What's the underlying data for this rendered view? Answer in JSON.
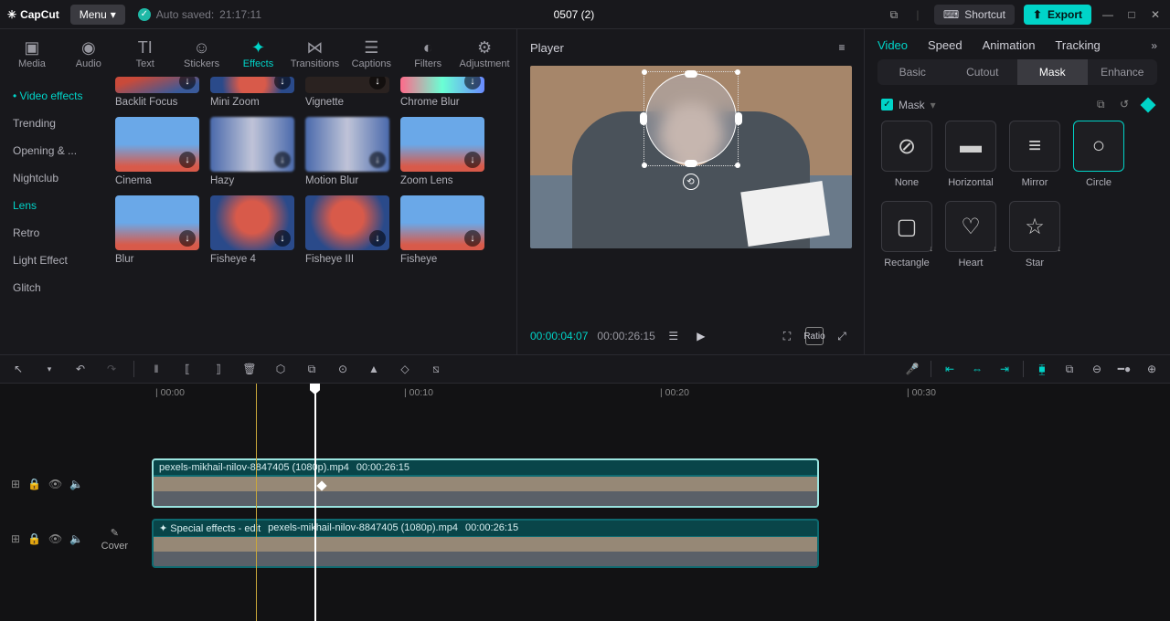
{
  "topbar": {
    "brand": "CapCut",
    "menu": "Menu",
    "autosave_label": "Auto saved:",
    "autosave_time": "21:17:11",
    "title": "0507 (2)",
    "shortcut": "Shortcut",
    "export": "Export"
  },
  "mediaTabs": [
    {
      "label": "Media",
      "icon": "▣"
    },
    {
      "label": "Audio",
      "icon": "◉"
    },
    {
      "label": "Text",
      "icon": "TI"
    },
    {
      "label": "Stickers",
      "icon": "☺"
    },
    {
      "label": "Effects",
      "icon": "✦",
      "active": true
    },
    {
      "label": "Transitions",
      "icon": "⋈"
    },
    {
      "label": "Captions",
      "icon": "☰"
    },
    {
      "label": "Filters",
      "icon": "◐"
    },
    {
      "label": "Adjustment",
      "icon": "⚙"
    }
  ],
  "categories": [
    {
      "label": "Video effects",
      "active": true,
      "bullet": true
    },
    {
      "label": "Trending"
    },
    {
      "label": "Opening & ..."
    },
    {
      "label": "Nightclub"
    },
    {
      "label": "Lens",
      "active": true
    },
    {
      "label": "Retro"
    },
    {
      "label": "Light Effect"
    },
    {
      "label": "Glitch"
    }
  ],
  "effects": {
    "row1": [
      {
        "l": "Backlit Focus",
        "c": "th-red"
      },
      {
        "l": "Mini Zoom",
        "c": "th-red2"
      },
      {
        "l": "Vignette",
        "c": "th-dark"
      },
      {
        "l": "Chrome Blur",
        "c": "th-chrome"
      }
    ],
    "row2": [
      {
        "l": "Cinema",
        "c": "th-sky"
      },
      {
        "l": "Hazy",
        "c": "th-blur"
      },
      {
        "l": "Motion Blur",
        "c": "th-blur"
      },
      {
        "l": "Zoom Lens",
        "c": "th-sky"
      }
    ],
    "row3": [
      {
        "l": "Blur",
        "c": "th-sky"
      },
      {
        "l": "Fisheye 4",
        "c": "th-red2"
      },
      {
        "l": "Fisheye III",
        "c": "th-red2"
      },
      {
        "l": "Fisheye",
        "c": "th-sky"
      }
    ]
  },
  "player": {
    "title": "Player",
    "current": "00:00:04:07",
    "total": "00:00:26:15",
    "ratio": "Ratio"
  },
  "propTabs": [
    {
      "label": "Video",
      "active": true
    },
    {
      "label": "Speed"
    },
    {
      "label": "Animation"
    },
    {
      "label": "Tracking"
    }
  ],
  "propSubs": [
    {
      "label": "Basic"
    },
    {
      "label": "Cutout"
    },
    {
      "label": "Mask",
      "active": true
    },
    {
      "label": "Enhance"
    }
  ],
  "maskLabel": "Mask",
  "maskShapes": [
    {
      "label": "None",
      "icon": "⊘"
    },
    {
      "label": "Horizontal",
      "icon": "▬"
    },
    {
      "label": "Mirror",
      "icon": "≡"
    },
    {
      "label": "Circle",
      "icon": "○",
      "active": true
    },
    {
      "label": "Rectangle",
      "icon": "▢",
      "dl": true
    },
    {
      "label": "Heart",
      "icon": "♡",
      "dl": true
    },
    {
      "label": "Star",
      "icon": "☆",
      "dl": true
    }
  ],
  "timeline": {
    "ticks": [
      "00:00",
      "00:10",
      "00:20",
      "00:30"
    ],
    "clip1": {
      "name": "pexels-mikhail-nilov-8847405 (1080p).mp4",
      "dur": "00:00:26:15"
    },
    "clip2": {
      "prefix": "✦ Special effects - edit",
      "name": "pexels-mikhail-nilov-8847405 (1080p).mp4",
      "dur": "00:00:26:15"
    },
    "cover": "Cover"
  }
}
